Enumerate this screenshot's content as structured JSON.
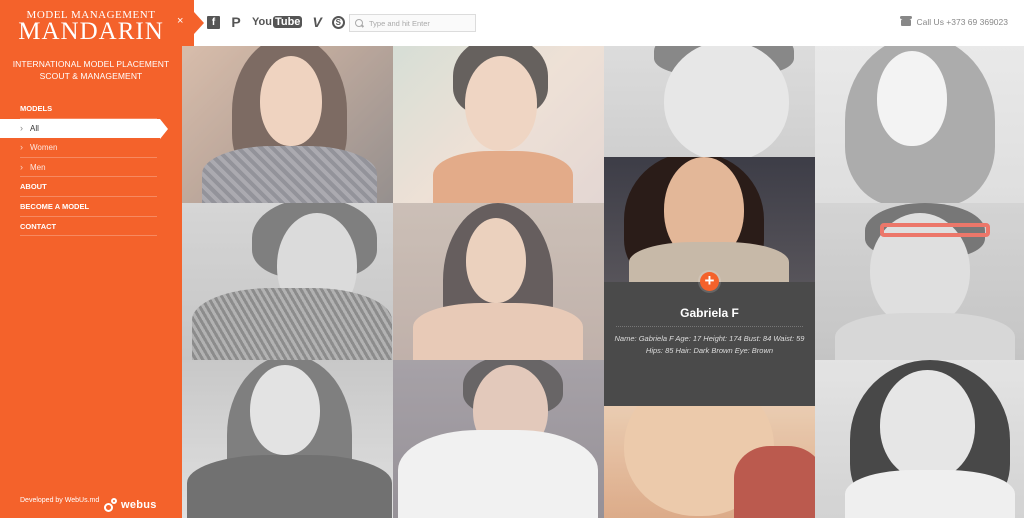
{
  "brand": {
    "subtitle": "MODEL MANAGEMENT",
    "name": "MANDARIN",
    "tagline_line1": "INTERNATIONAL MODEL PLACEMENT",
    "tagline_line2": "SCOUT & MANAGEMENT"
  },
  "nav": {
    "models": "MODELS",
    "all": "All",
    "women": "Women",
    "men": "Men",
    "about": "ABOUT",
    "become": "BECOME A MODEL",
    "contact": "CONTACT"
  },
  "footer": {
    "credit": "Developed by WebUs.md",
    "logo_text": "webus"
  },
  "topbar": {
    "close_glyph": "×",
    "social": {
      "facebook": "f",
      "pinterest": "P",
      "youtube_you": "You",
      "youtube_tube": "Tube",
      "vimeo": "V",
      "skype": "S"
    },
    "search_placeholder": "Type and hit Enter",
    "call_text": "Call Us  +373 69 369023"
  },
  "featured": {
    "plus": "+",
    "name": "Gabriela F",
    "details": "Name: Gabriela F Age: 17 Height: 174 Bust: 84 Waist: 59 Hips: 85 Hair: Dark Brown Eye: Brown"
  },
  "colors": {
    "accent": "#f4622b",
    "card_bg": "#4a4a4a"
  },
  "tiles": [
    {
      "name": "model-tile-1",
      "label": "woman in plaid"
    },
    {
      "name": "model-tile-2",
      "label": "woman with earrings"
    },
    {
      "name": "model-tile-3",
      "label": "man close-up"
    },
    {
      "name": "model-tile-4",
      "label": "woman long hair"
    },
    {
      "name": "model-tile-5",
      "label": "man studded jacket"
    },
    {
      "name": "model-tile-6",
      "label": "woman dark hair"
    },
    {
      "name": "model-tile-7",
      "label": "Gabriela F"
    },
    {
      "name": "model-tile-8",
      "label": "man with glasses"
    },
    {
      "name": "model-tile-9",
      "label": "woman dark top"
    },
    {
      "name": "model-tile-10",
      "label": "man glasses hand"
    },
    {
      "name": "model-tile-11",
      "label": "woman close-up lips"
    },
    {
      "name": "model-tile-12",
      "label": "woman portrait"
    }
  ]
}
